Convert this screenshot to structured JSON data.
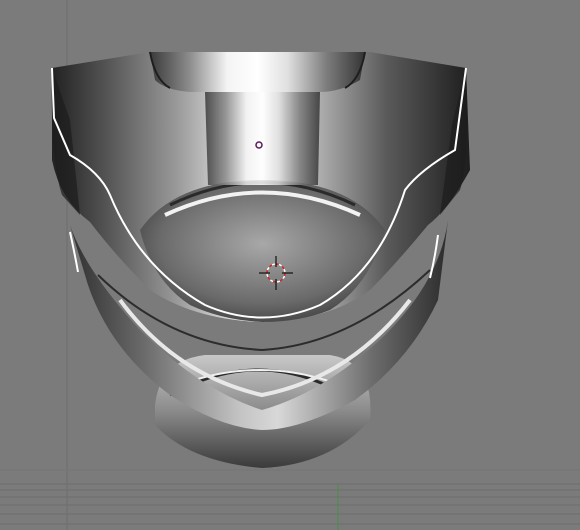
{
  "viewport": {
    "mode": "3d-view",
    "background_color": "#7b7b7b",
    "grid_color": "#6e6e6e",
    "axis_green_color": "#4a8c4a",
    "selected_edge_color": "#ffffff",
    "object": "mask-mesh",
    "shading": "solid"
  },
  "icons": {
    "cursor": "3d-cursor-icon",
    "origin": "object-origin-icon"
  }
}
